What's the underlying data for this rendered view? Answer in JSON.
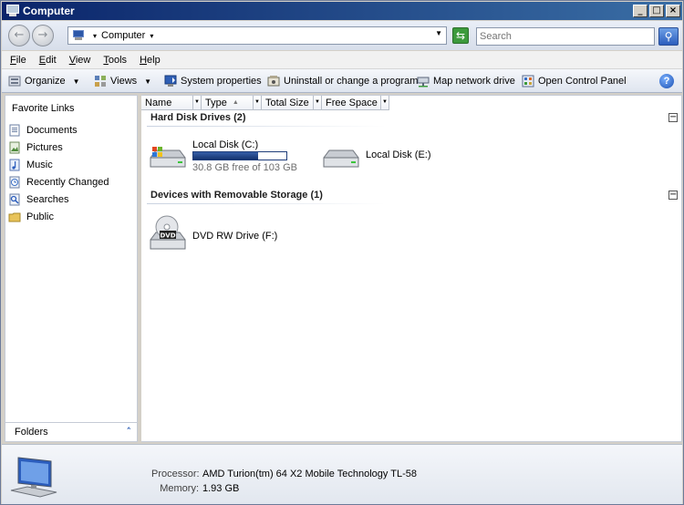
{
  "window": {
    "title": "Computer",
    "caption_buttons": [
      "_",
      "□",
      "×"
    ]
  },
  "address_bar": {
    "crumb_prefix_arrow": "▾",
    "location": "Computer",
    "crumb_arrow": "▾",
    "dropdown_arrow": "▼",
    "search_placeholder": "Search"
  },
  "menu": [
    {
      "accel": "F",
      "rest": "ile"
    },
    {
      "accel": "E",
      "rest": "dit"
    },
    {
      "accel": "V",
      "rest": "iew"
    },
    {
      "accel": "T",
      "rest": "ools"
    },
    {
      "accel": "H",
      "rest": "elp"
    }
  ],
  "toolbar": {
    "organize": "Organize",
    "views": "Views",
    "system_properties": "System properties",
    "uninstall": "Uninstall or change a program",
    "map_drive": "Map network drive",
    "control_panel": "Open Control Panel",
    "help": "?",
    "dropdown_arrow": "▼"
  },
  "left_pane": {
    "favorites_title": "Favorite Links",
    "links": [
      {
        "label": "Documents",
        "icon": "documents-icon"
      },
      {
        "label": "Pictures",
        "icon": "pictures-icon"
      },
      {
        "label": "Music",
        "icon": "music-icon"
      },
      {
        "label": "Recently Changed",
        "icon": "recently-changed-icon"
      },
      {
        "label": "Searches",
        "icon": "searches-icon"
      },
      {
        "label": "Public",
        "icon": "public-folder-icon"
      }
    ],
    "folders_label": "Folders",
    "folders_chevron": "˄"
  },
  "columns": {
    "name": "Name",
    "type": "Type",
    "total_size": "Total Size",
    "free_space": "Free Space",
    "sort_indicator": "▲",
    "dropdown_arrow": "▼"
  },
  "groups": {
    "hard_disks": {
      "title": "Hard Disk Drives (2)",
      "collapse": "−",
      "drive_c": {
        "label": "Local Disk (C:)",
        "free": "30.8 GB free of 103 GB",
        "used_fraction": 0.7
      },
      "drive_e": {
        "label": "Local Disk (E:)"
      }
    },
    "removable": {
      "title": "Devices with Removable Storage (1)",
      "collapse": "−",
      "dvd": {
        "label": "DVD RW Drive (F:)",
        "badge": "DVD"
      }
    }
  },
  "details": {
    "processor_label": "Processor:",
    "processor_value": "AMD Turion(tm) 64 X2 Mobile Technology TL-58",
    "memory_label": "Memory:",
    "memory_value": "1.93 GB"
  },
  "colors": {
    "title_bar": "#0a246a",
    "usage_bar": "#15336e",
    "accent": "#2b5dbd"
  }
}
